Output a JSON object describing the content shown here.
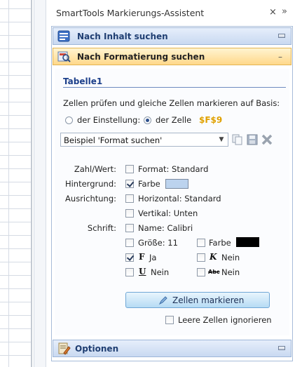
{
  "pane": {
    "title": "SmartTools Markierungs-Assistent",
    "close_glyph": "×",
    "more_glyph": "»"
  },
  "sections": {
    "content_search": "Nach Inhalt suchen",
    "format_search": "Nach Formatierung suchen",
    "options": "Optionen"
  },
  "table": {
    "title": "Tabelle1",
    "instruction": "Zellen prüfen und gleiche Zellen markieren auf Basis:",
    "radio_setting": "der Einstellung:",
    "radio_cell": "der Zelle",
    "cell_address": "$F$9",
    "preset_value": "Beispiel 'Format suchen'"
  },
  "criteria": {
    "number_label": "Zahl/Wert:",
    "number_option": "Format: Standard",
    "background_label": "Hintergrund:",
    "background_option": "Farbe",
    "background_color": "#bcd3ee",
    "alignment_label": "Ausrichtung:",
    "horizontal_option": "Horizontal: Standard",
    "vertical_option": "Vertikal: Unten",
    "font_label": "Schrift:",
    "font_name_option": "Name: Calibri",
    "font_size_option": "Größe: 11",
    "font_color_option": "Farbe",
    "font_color": "#000000",
    "bold_glyph": "F",
    "bold_value": "Ja",
    "italic_glyph": "K",
    "italic_value": "Nein",
    "underline_glyph": "U",
    "underline_value": "Nein",
    "strike_glyph": "Abc",
    "strike_value": "Nein"
  },
  "actions": {
    "mark_button": "Zellen markieren",
    "ignore_empty": "Leere Zellen ignorieren"
  },
  "state": {
    "radio_selected": "cell",
    "number_checked": false,
    "background_checked": true,
    "horizontal_checked": false,
    "vertical_checked": false,
    "font_name_checked": false,
    "font_size_checked": false,
    "font_color_checked": false,
    "bold_checked": true,
    "italic_checked": false,
    "underline_checked": false,
    "strike_checked": false,
    "ignore_empty_checked": false
  }
}
